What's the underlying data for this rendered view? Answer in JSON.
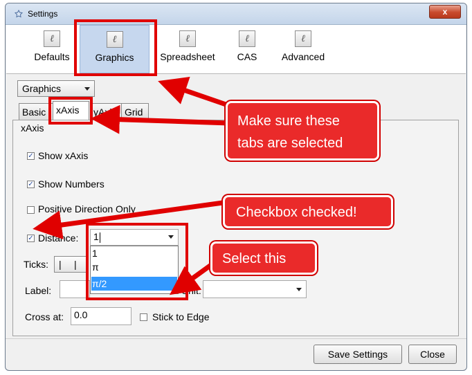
{
  "window": {
    "title": "Settings",
    "close_label": "x"
  },
  "toolbar": {
    "items": [
      {
        "label": "Defaults",
        "icon": "pencil-icon"
      },
      {
        "label": "Graphics",
        "icon": "pencil-icon"
      },
      {
        "label": "Spreadsheet",
        "icon": "pencil-icon"
      },
      {
        "label": "CAS",
        "icon": "pencil-icon"
      },
      {
        "label": "Advanced",
        "icon": "pencil-icon"
      }
    ],
    "selected": "Graphics"
  },
  "view_select": {
    "value": "Graphics"
  },
  "tabs": [
    {
      "label": "Basic"
    },
    {
      "label": "xAxis"
    },
    {
      "label": "yAxis"
    },
    {
      "label": "Grid"
    }
  ],
  "selected_tab": "xAxis",
  "panel": {
    "section_title": "xAxis",
    "show_xaxis": {
      "label": "Show xAxis",
      "checked": true
    },
    "show_numbers": {
      "label": "Show Numbers",
      "checked": true
    },
    "positive_direction": {
      "label": "Positive Direction Only",
      "checked": false
    },
    "distance": {
      "label": "Distance:",
      "checked": true,
      "value": "1"
    },
    "distance_options": [
      "1",
      "π",
      "π/2"
    ],
    "distance_highlighted": "π/2",
    "ticks_label": "Ticks:",
    "ticks_values": [
      "|",
      "|"
    ],
    "label_label": "Label:",
    "unit_label": "Unit:",
    "cross_at_label": "Cross at:",
    "cross_at_value": "0.0",
    "stick_to_edge": {
      "label": "Stick to Edge",
      "checked": false
    }
  },
  "footer": {
    "save_label": "Save Settings",
    "close_label": "Close"
  },
  "annotations": {
    "tabs_note": "Make sure these tabs are selected",
    "tabs_note_line1": "Make sure these",
    "tabs_note_line2": "tabs are selected",
    "checkbox_note": "Checkbox checked!",
    "select_note": "Select this"
  },
  "colors": {
    "annotation_red": "#e00000",
    "selection_blue": "#3399ff",
    "toolbar_selected": "#c6d7ee"
  }
}
